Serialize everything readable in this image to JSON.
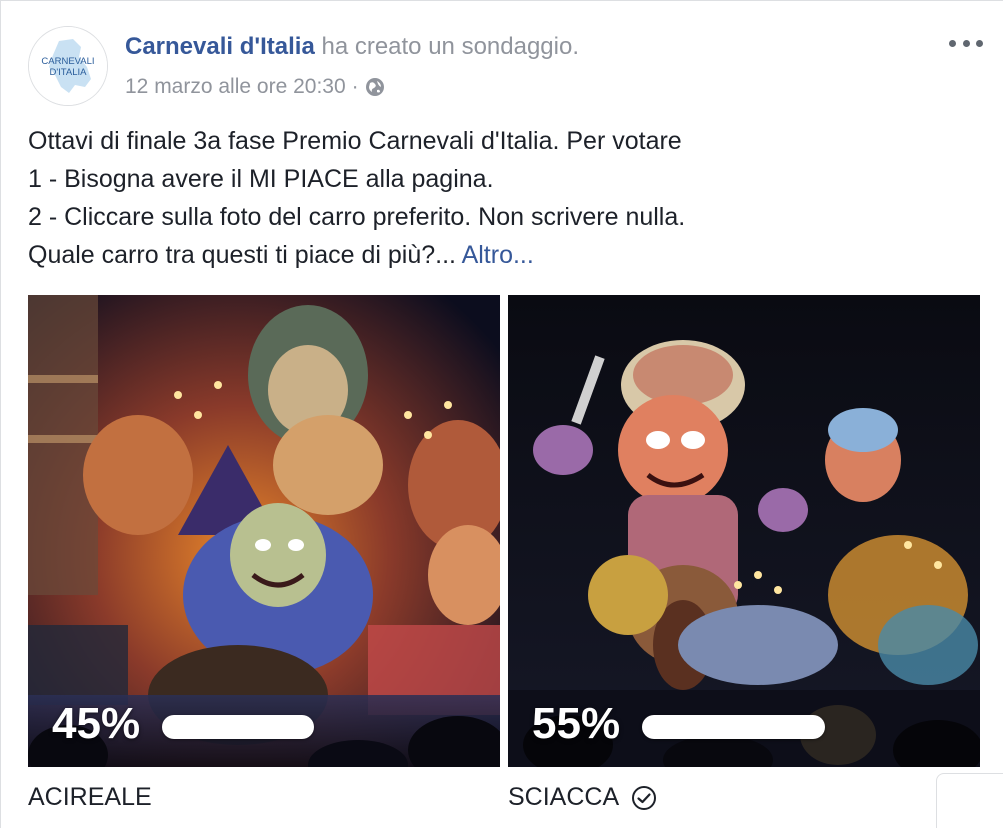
{
  "header": {
    "author": "Carnevali d'Italia",
    "action": " ha creato un sondaggio.",
    "timestamp": "12 marzo alle ore 20:30",
    "separator": "·",
    "privacy_icon": "globe-icon",
    "more_icon": "more-options-icon",
    "avatar_text_line1": "CARNEVALI",
    "avatar_text_line2": "D'ITALIA"
  },
  "post": {
    "lines": [
      "Ottavi di finale 3a fase Premio Carnevali d'Italia. Per votare",
      "1 - Bisogna avere il MI PIACE alla pagina.",
      "2 - Cliccare sulla foto del carro preferito. Non scrivere nulla.",
      "Quale carro tra questi ti piace di più?... "
    ],
    "more_link": "Altro..."
  },
  "poll": {
    "options": [
      {
        "label": "ACIREALE",
        "percent_text": "45%",
        "percent": 45,
        "selected": false
      },
      {
        "label": "SCIACCA",
        "percent_text": "55%",
        "percent": 55,
        "selected": true
      }
    ]
  },
  "colors": {
    "link": "#365899",
    "secondary_text": "#90949c",
    "body_text": "#1d2129"
  }
}
